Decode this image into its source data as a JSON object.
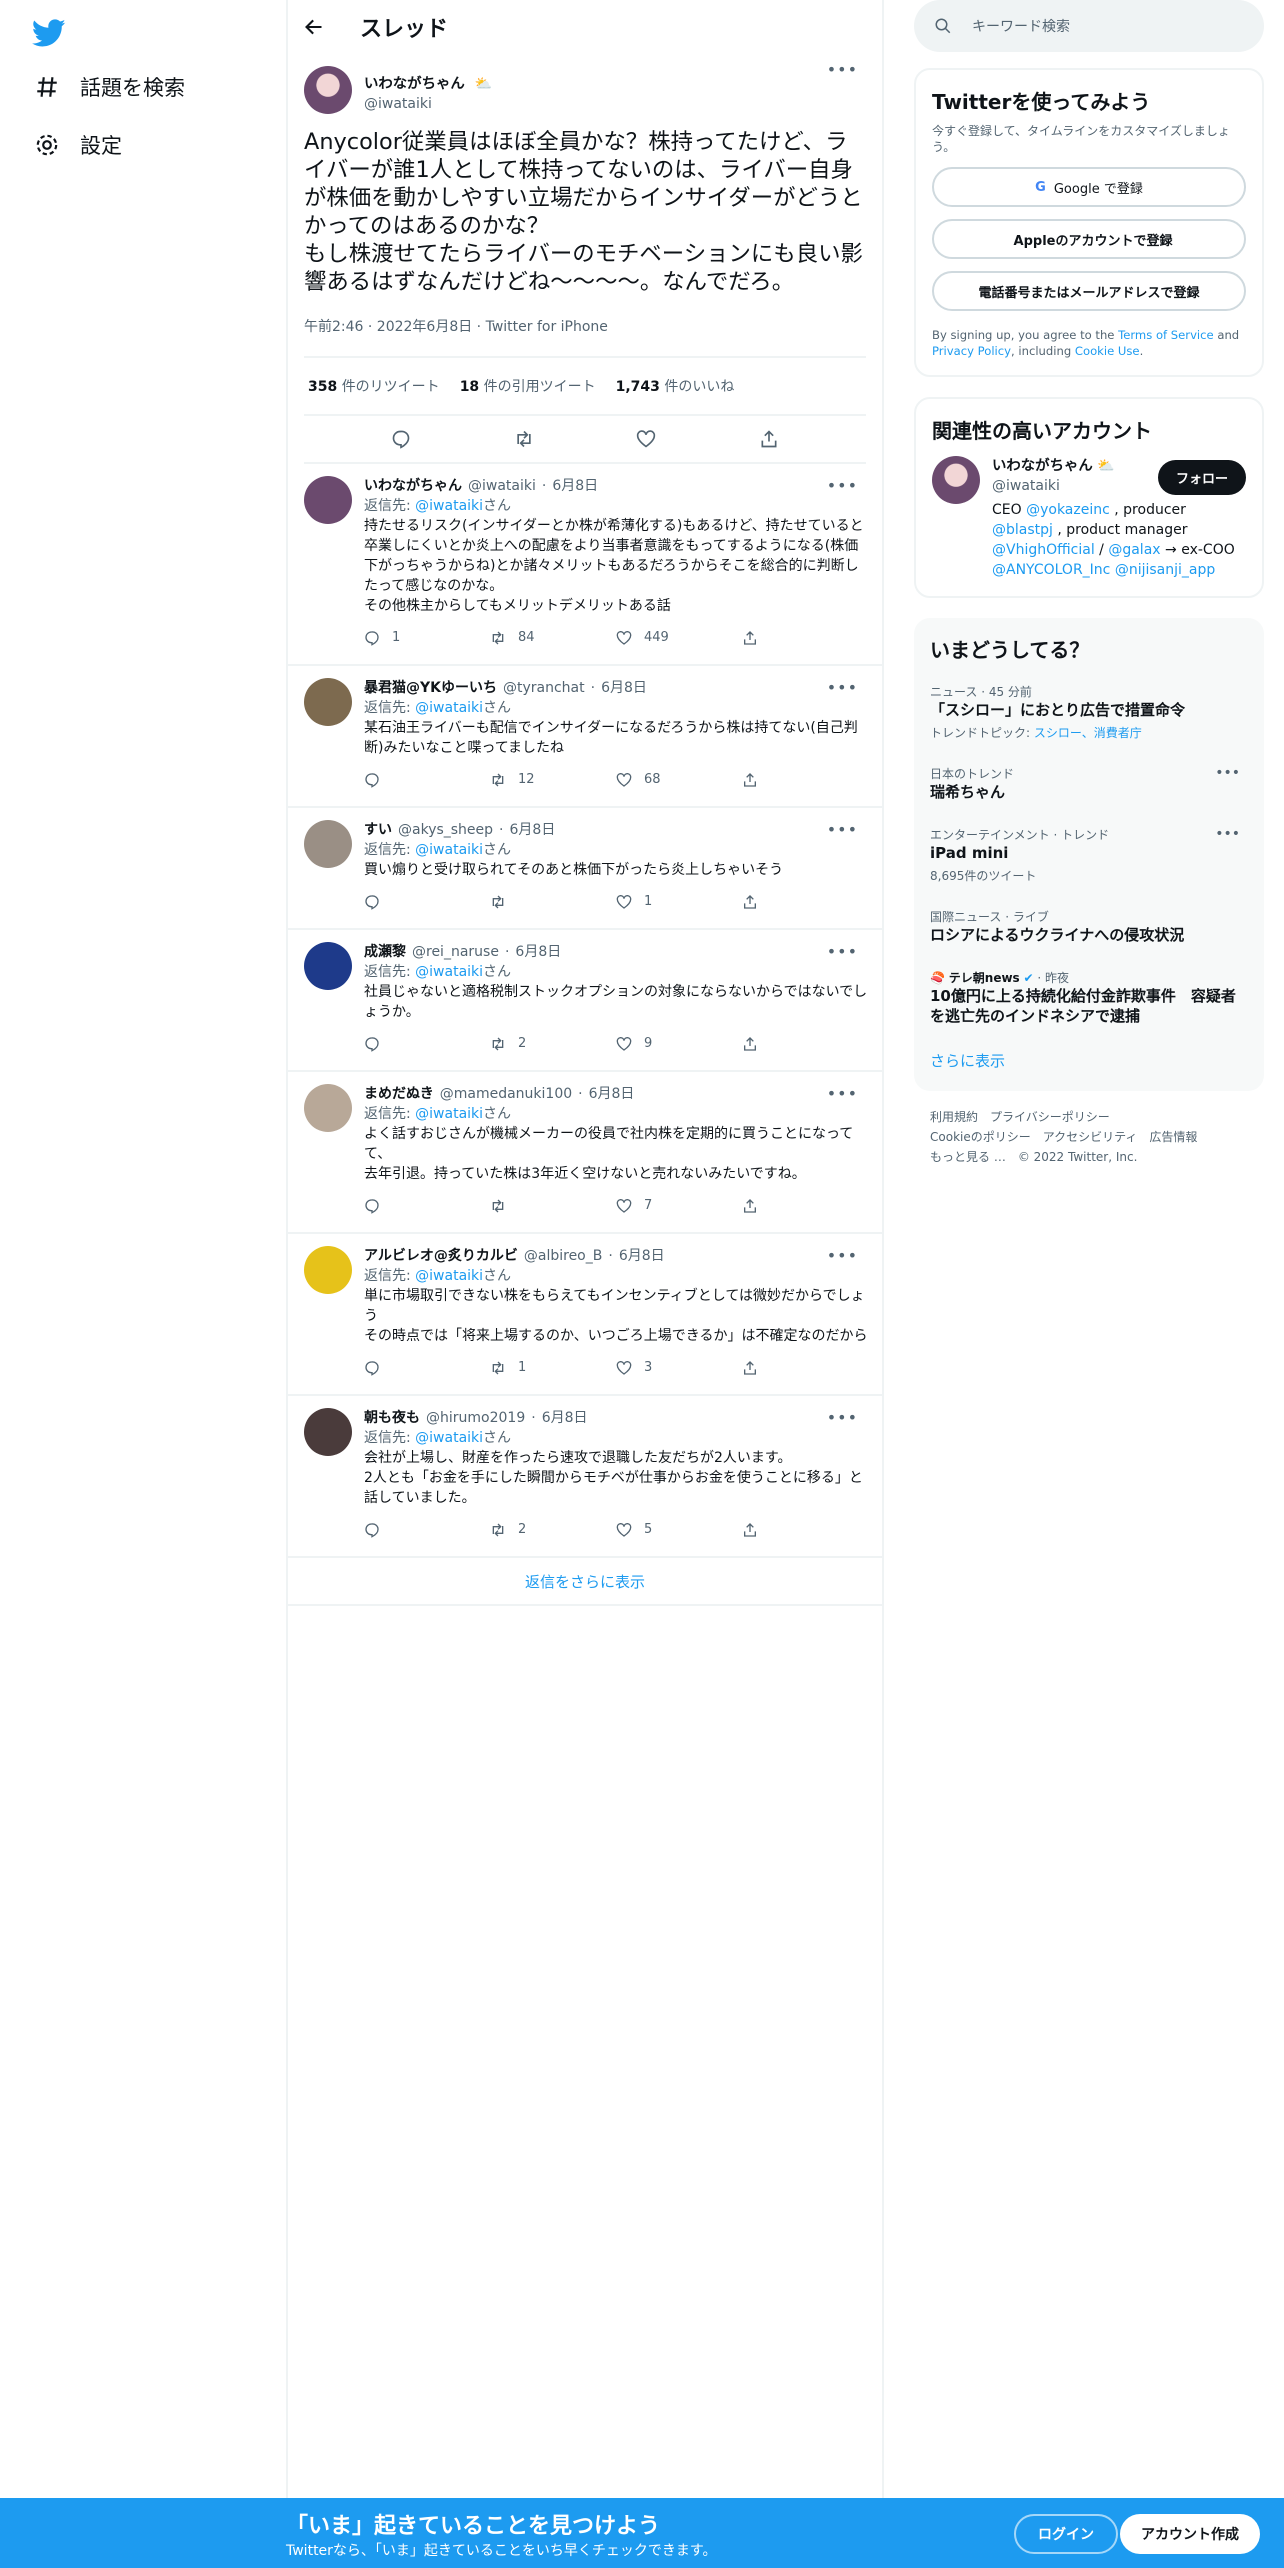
{
  "nav": {
    "explore": "話題を検索",
    "settings": "設定"
  },
  "header": {
    "title": "スレッド"
  },
  "op": {
    "name": "いわながちゃん",
    "handle": "@iwataiki",
    "text": "Anycolor従業員はほぼ全員かな？株持ってたけど、ライバーが誰1人として株持ってないのは、ライバー自身が株価を動かしやすい立場だからインサイダーがどうとかってのはあるのかな？\nもし株渡せてたらライバーのモチベーションにも良い影響あるはずなんだけどね〜〜〜〜。なんでだろ。",
    "meta": "午前2:46 · 2022年6月8日 · Twitter for iPhone",
    "retweets": "358",
    "retweets_label": "件のリツイート",
    "quotes": "18",
    "quotes_label": "件の引用ツイート",
    "likes": "1,743",
    "likes_label": "件のいいね"
  },
  "replies": [
    {
      "name": "いわながちゃん",
      "handle": "@iwataiki",
      "date": "6月8日",
      "reply_prefix": "返信先: ",
      "reply_to": "@iwataiki",
      "reply_suffix": "さん",
      "text": "持たせるリスク(インサイダーとか株が希薄化する)もあるけど、持たせていると卒業しにくいとか炎上への配慮をより当事者意識をもってするようになる(株価下がっちゃうからね)とか諸々メリットもあるだろうからそこを総合的に判断したって感じなのかな。\nその他株主からしてもメリットデメリットある話",
      "replies": "1",
      "retweets": "84",
      "likes": "449",
      "avatar_color": "#6b4a6e"
    },
    {
      "name": "暴君猫@YKゆーいち",
      "handle": "@tyranchat",
      "date": "6月8日",
      "reply_prefix": "返信先: ",
      "reply_to": "@iwataiki",
      "reply_suffix": "さん",
      "text": "某石油王ライバーも配信でインサイダーになるだろうから株は持てない(自己判断)みたいなこと喋ってましたね",
      "replies": "",
      "retweets": "12",
      "likes": "68",
      "avatar_color": "#7d6a4f"
    },
    {
      "name": "すい",
      "handle": "@akys_sheep",
      "date": "6月8日",
      "reply_prefix": "返信先: ",
      "reply_to": "@iwataiki",
      "reply_suffix": "さん",
      "text": "買い煽りと受け取られてそのあと株価下がったら炎上しちゃいそう",
      "replies": "",
      "retweets": "",
      "likes": "1",
      "avatar_color": "#9a8f85"
    },
    {
      "name": "成瀬黎",
      "handle": "@rei_naruse",
      "date": "6月8日",
      "reply_prefix": "返信先: ",
      "reply_to": "@iwataiki",
      "reply_suffix": "さん",
      "text": "社員じゃないと適格税制ストックオプションの対象にならないからではないでしょうか。",
      "replies": "",
      "retweets": "2",
      "likes": "9",
      "avatar_color": "#1e3a8a"
    },
    {
      "name": "まめだぬき",
      "handle": "@mamedanuki100",
      "date": "6月8日",
      "reply_prefix": "返信先: ",
      "reply_to": "@iwataiki",
      "reply_suffix": "さん",
      "text": "よく話すおじさんが機械メーカーの役員で社内株を定期的に買うことになってて、\n去年引退。持っていた株は3年近く空けないと売れないみたいですね。",
      "replies": "",
      "retweets": "",
      "likes": "7",
      "avatar_color": "#b8a898"
    },
    {
      "name": "アルビレオ@炙りカルビ",
      "handle": "@albireo_B",
      "date": "6月8日",
      "reply_prefix": "返信先: ",
      "reply_to": "@iwataiki",
      "reply_suffix": "さん",
      "text": "単に市場取引できない株をもらえてもインセンティブとしては微妙だからでしょう\nその時点では「将来上場するのか、いつごろ上場できるか」は不確定なのだから",
      "replies": "",
      "retweets": "1",
      "likes": "3",
      "avatar_color": "#e6c21a"
    },
    {
      "name": "朝も夜も",
      "handle": "@hirumo2019",
      "date": "6月8日",
      "reply_prefix": "返信先: ",
      "reply_to": "@iwataiki",
      "reply_suffix": "さん",
      "text": "会社が上場し、財産を作ったら速攻で退職した友だちが2人います。\n2人とも「お金を手にした瞬間からモチベが仕事からお金を使うことに移る」と話していました。",
      "replies": "",
      "retweets": "2",
      "likes": "5",
      "avatar_color": "#4a3b3b"
    }
  ],
  "show_more_replies": "返信をさらに表示",
  "search": {
    "placeholder": "キーワード検索"
  },
  "signup": {
    "title": "Twitterを使ってみよう",
    "subtitle": "今すぐ登録して、タイムラインをカスタマイズしましょう。",
    "google": "Google で登録",
    "apple": "Appleのアカウントで登録",
    "phone": "電話番号またはメールアドレスで登録",
    "legal_1": "By signing up, you agree to the ",
    "tos": "Terms of Service",
    "legal_2": " and ",
    "privacy": "Privacy Policy",
    "legal_3": ", including ",
    "cookie": "Cookie Use",
    "legal_4": "."
  },
  "relevant": {
    "title": "関連性の高いアカウント",
    "name": "いわながちゃん",
    "handle": "@iwataiki",
    "follow": "フォロー",
    "bio_1": "CEO ",
    "m1": "@yokazeinc",
    "bio_2": " , producer ",
    "m2": "@blastpj",
    "bio_3": " , product manager ",
    "m3": "@VhighOfficial",
    "bio_4": " / ",
    "m4": "@galax",
    "bio_5": " → ex-COO ",
    "m5": "@ANYCOLOR_Inc",
    "m6": "@nijisanji_app"
  },
  "trends": {
    "title": "いまどうしてる？",
    "items": [
      {
        "cat": "ニュース · 45 分前",
        "title": "「スシロー」におとり広告で措置命令",
        "extra_prefix": "トレンドトピック: ",
        "extra_links": "スシロー、消費者庁"
      },
      {
        "cat": "日本のトレンド",
        "title": "瑞希ちゃん"
      },
      {
        "cat": "エンターテインメント · トレンド",
        "title": "iPad mini",
        "extra": "8,695件のツイート"
      },
      {
        "cat": "国際ニュース · ライブ",
        "title": "ロシアによるウクライナへの侵攻状況"
      },
      {
        "cat_source": "テレ朝news",
        "cat_time": " · 昨夜",
        "title": "10億円に上る持続化給付金詐欺事件　容疑者を逃亡先のインドネシアで逮捕"
      }
    ],
    "show_more": "さらに表示"
  },
  "footer": {
    "l1": "利用規約",
    "l2": "プライバシーポリシー",
    "l3": "Cookieのポリシー",
    "l4": "アクセシビリティ",
    "l5": "広告情報",
    "l6": "もっと見る …",
    "l7": "© 2022 Twitter, Inc."
  },
  "banner": {
    "title": "「いま」起きていることを見つけよう",
    "subtitle": "Twitterなら、「いま」起きていることをいち早くチェックできます。",
    "login": "ログイン",
    "signup": "アカウント作成"
  },
  "colors": {
    "brand": "#1d9bf0",
    "text": "#0f1419",
    "muted": "#536471"
  }
}
